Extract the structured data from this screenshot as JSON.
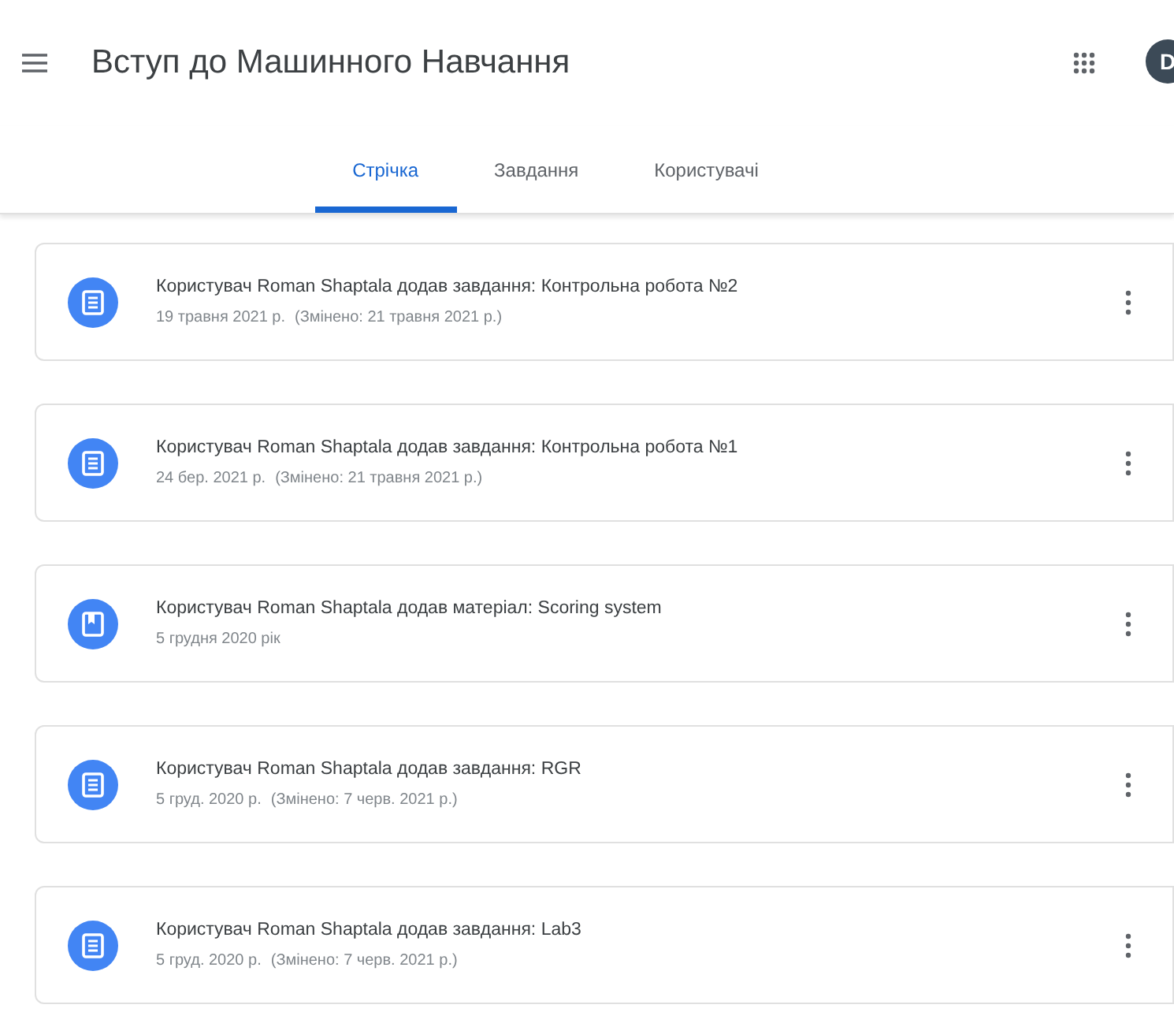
{
  "header": {
    "title": "Вступ до Машинного Навчання",
    "avatar": "D"
  },
  "tabs": [
    {
      "label": "Стрічка",
      "selected": true
    },
    {
      "label": "Завдання",
      "selected": false
    },
    {
      "label": "Користувачі",
      "selected": false
    }
  ],
  "posts": [
    {
      "kind": "assignment",
      "text": "Користувач Roman Shaptala додав завдання: Контрольна робота №2",
      "date": "19 травня 2021 р.",
      "edited": "(Змінено: 21 травня 2021 р.)"
    },
    {
      "kind": "assignment",
      "text": "Користувач Roman Shaptala додав завдання: Контрольна робота №1",
      "date": "24 бер. 2021 р.",
      "edited": "(Змінено: 21 травня 2021 р.)"
    },
    {
      "kind": "material",
      "text": "Користувач Roman Shaptala додав матеріал: Scoring system",
      "date": "5 грудня 2020 рік"
    },
    {
      "kind": "assignment",
      "text": "Користувач Roman Shaptala додав завдання: RGR",
      "date": "5 груд. 2020 р.",
      "edited": "(Змінено: 7 черв. 2021 р.)"
    },
    {
      "kind": "assignment",
      "text": "Користувач Roman Shaptala додав завдання: Lab3",
      "date": "5 груд. 2020 р.",
      "edited": "(Змінено: 7 черв. 2021 р.)"
    }
  ]
}
